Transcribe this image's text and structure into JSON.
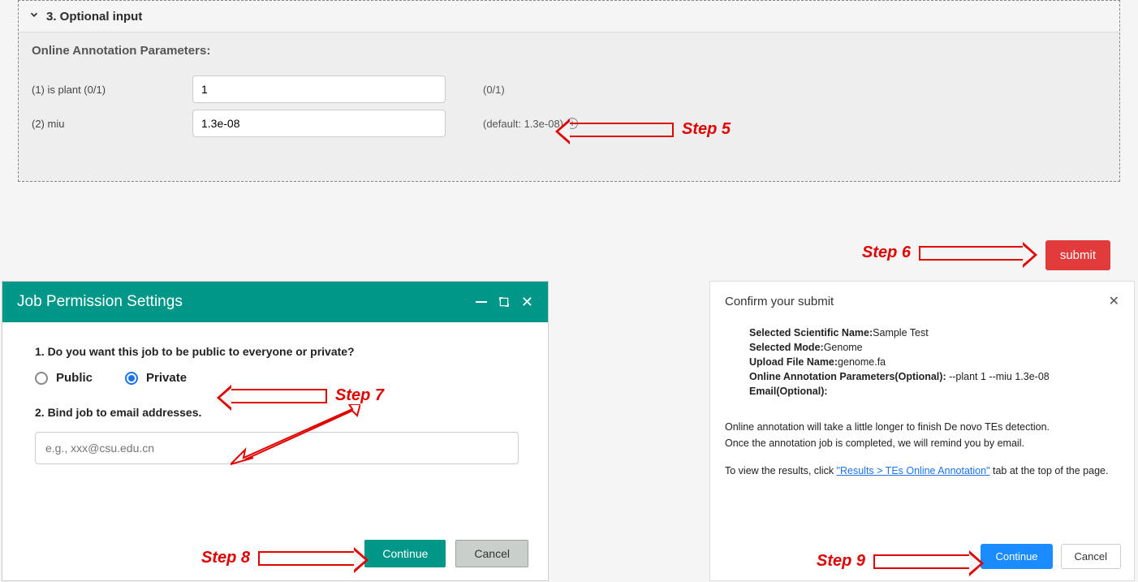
{
  "accordion": {
    "title": "3. Optional input",
    "section_label": "Online Annotation Parameters:",
    "params": [
      {
        "label": "(1) is plant (0/1)",
        "value": "1",
        "hint": "(0/1)"
      },
      {
        "label": "(2) miu",
        "value": "1.3e-08",
        "hint": "(default: 1.3e-08)"
      }
    ]
  },
  "submit_label": "submit",
  "steps": {
    "s5": "Step 5",
    "s6": "Step 6",
    "s7": "Step 7",
    "s8": "Step 8",
    "s9": "Step 9"
  },
  "modal1": {
    "title": "Job Permission Settings",
    "q1": "1. Do you want this job to be public to everyone or private?",
    "public": "Public",
    "private": "Private",
    "q2": "2. Bind job to email addresses.",
    "email_placeholder": "e.g., xxx@csu.edu.cn",
    "continue": "Continue",
    "cancel": "Cancel"
  },
  "modal2": {
    "title": "Confirm your submit",
    "rows": {
      "name_label": "Selected Scientific Name:",
      "name_value": "Sample Test",
      "mode_label": "Selected Mode:",
      "mode_value": "Genome",
      "file_label": "Upload File Name:",
      "file_value": "genome.fa",
      "params_label": "Online Annotation Parameters(Optional):",
      "params_value": " --plant 1 --miu 1.3e-08",
      "email_label": "Email(Optional):",
      "email_value": ""
    },
    "note1": "Online annotation will take a little longer to finish De novo TEs detection.",
    "note2": "Once the annotation job is completed, we will remind you by email.",
    "note3a": "To view the results, click ",
    "note3_link": "\"Results > TEs Online Annotation\"",
    "note3b": " tab at the top of the page.",
    "continue": "Continue",
    "cancel": "Cancel"
  }
}
